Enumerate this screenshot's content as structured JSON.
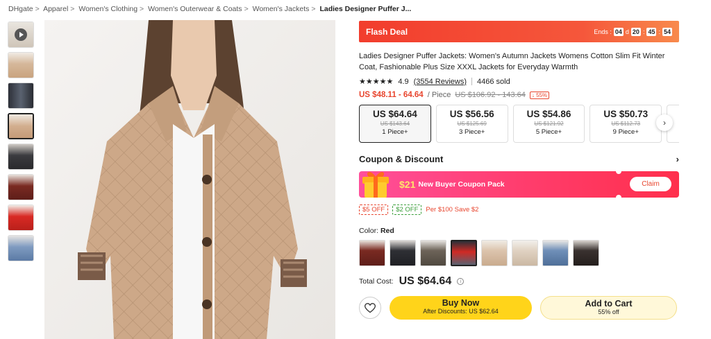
{
  "breadcrumb": [
    "DHgate",
    "Apparel",
    "Women's Clothing",
    "Women's Outerwear & Coats",
    "Women's Jackets",
    "Ladies Designer Puffer J..."
  ],
  "flash": {
    "label": "Flash Deal",
    "ends_label": "Ends :",
    "days": "04",
    "d": "d",
    "hours": "20",
    "minutes": "45",
    "seconds": "54"
  },
  "product": {
    "title": "Ladies Designer Puffer Jackets: Women's Autumn Jackets Womens Cotton Slim Fit Winter Coat, Fashionable Plus Size XXXL Jackets for Everyday Warmth",
    "stars": "★★★★★",
    "rating": "4.9",
    "reviews": "(3554 Reviews)",
    "sold": "4466 sold",
    "price_range": "US $48.11 - 64.64",
    "per_piece": "/ Piece",
    "old_range": "US $106.92 - 143.64",
    "discount": "↓ 55%"
  },
  "tiers": [
    {
      "price": "US $64.64",
      "old": "US $143.64",
      "qty": "1 Piece+"
    },
    {
      "price": "US $56.56",
      "old": "US $125.69",
      "qty": "3 Piece+"
    },
    {
      "price": "US $54.86",
      "old": "US $121.92",
      "qty": "5 Piece+"
    },
    {
      "price": "US $50.73",
      "old": "US $112.73",
      "qty": "9 Piece+"
    }
  ],
  "coupon": {
    "heading": "Coupon & Discount",
    "amount": "$21",
    "text": "New Buyer Coupon Pack",
    "claim": "Claim",
    "chip1": "$5 OFF",
    "chip2": "$2 OFF",
    "note": "Per $100 Save $2"
  },
  "color": {
    "label": "Color:",
    "value": "Red"
  },
  "total": {
    "label": "Total Cost:",
    "value": "US $64.64",
    "info": "i"
  },
  "buttons": {
    "buy": "Buy Now",
    "buy_sub": "After Discounts:  US $62.64",
    "cart": "Add to Cart",
    "cart_sub": "55% off"
  },
  "colors": {
    "accent": "#e8452e",
    "buy": "#ffd41a",
    "flash": "#f23d2d"
  }
}
